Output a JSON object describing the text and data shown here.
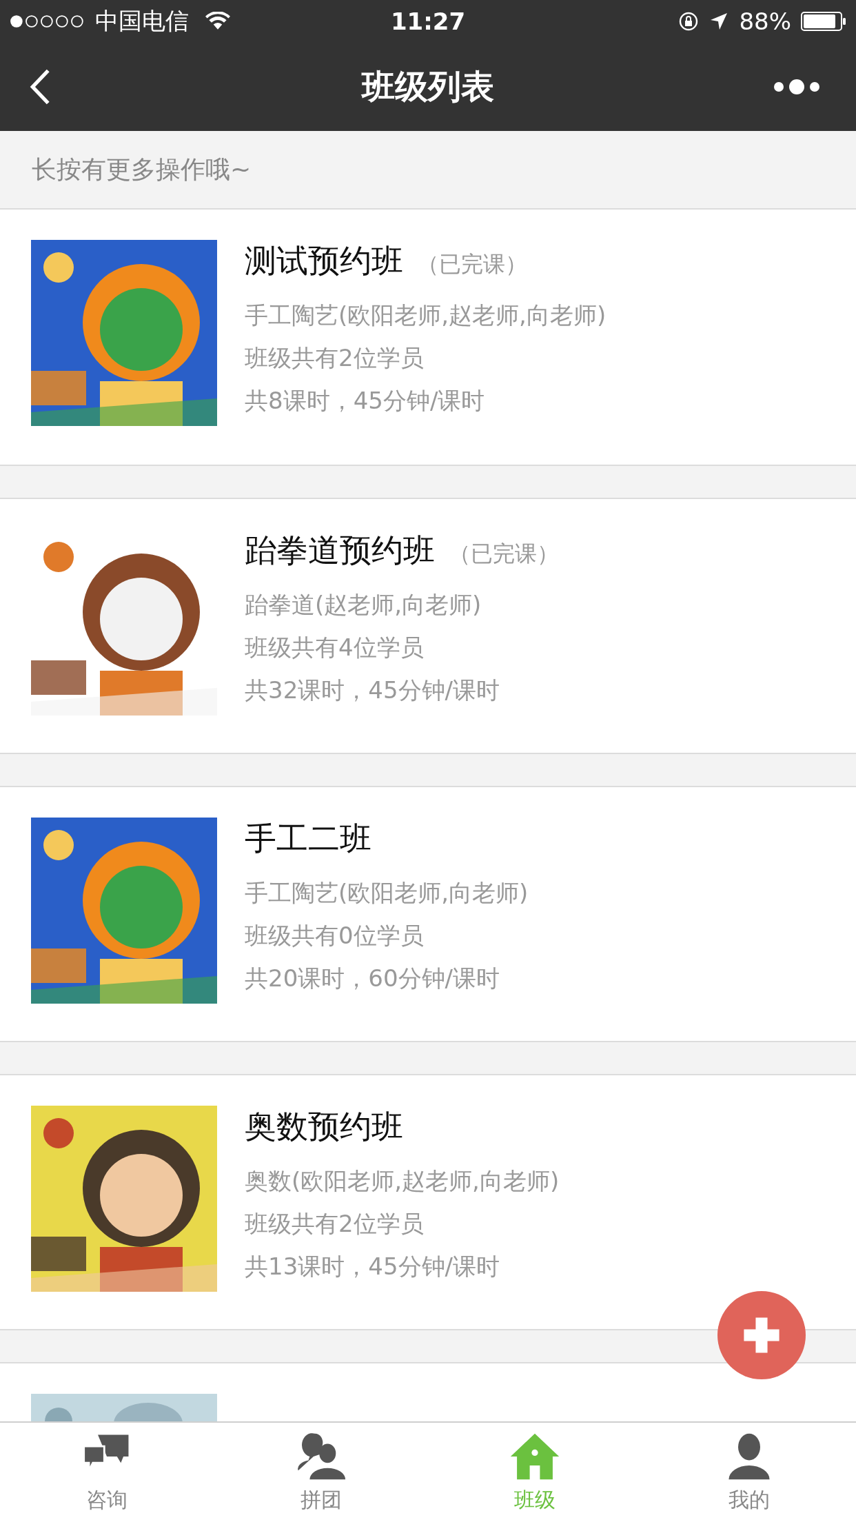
{
  "status_bar": {
    "carrier": "中国电信",
    "time": "11:27",
    "battery": "88%"
  },
  "nav": {
    "title": "班级列表"
  },
  "hint": "长按有更多操作哦~",
  "classes": [
    {
      "title": "测试预约班",
      "tag": "（已完课）",
      "teachers": "手工陶艺(欧阳老师,赵老师,向老师)",
      "students": "班级共有2位学员",
      "hours": "共8课时，45分钟/课时"
    },
    {
      "title": "跆拳道预约班",
      "tag": "（已完课）",
      "teachers": "跆拳道(赵老师,向老师)",
      "students": "班级共有4位学员",
      "hours": "共32课时，45分钟/课时"
    },
    {
      "title": "手工二班",
      "teachers": "手工陶艺(欧阳老师,向老师)",
      "students": "班级共有0位学员",
      "hours": "共20课时，60分钟/课时"
    },
    {
      "title": "奥数预约班",
      "teachers": "奥数(欧阳老师,赵老师,向老师)",
      "students": "班级共有2位学员",
      "hours": "共13课时，45分钟/课时"
    }
  ],
  "tabs": [
    {
      "label": "咨询",
      "selected": false
    },
    {
      "label": "拼团",
      "selected": false
    },
    {
      "label": "班级",
      "selected": true
    },
    {
      "label": "我的",
      "selected": false
    }
  ]
}
